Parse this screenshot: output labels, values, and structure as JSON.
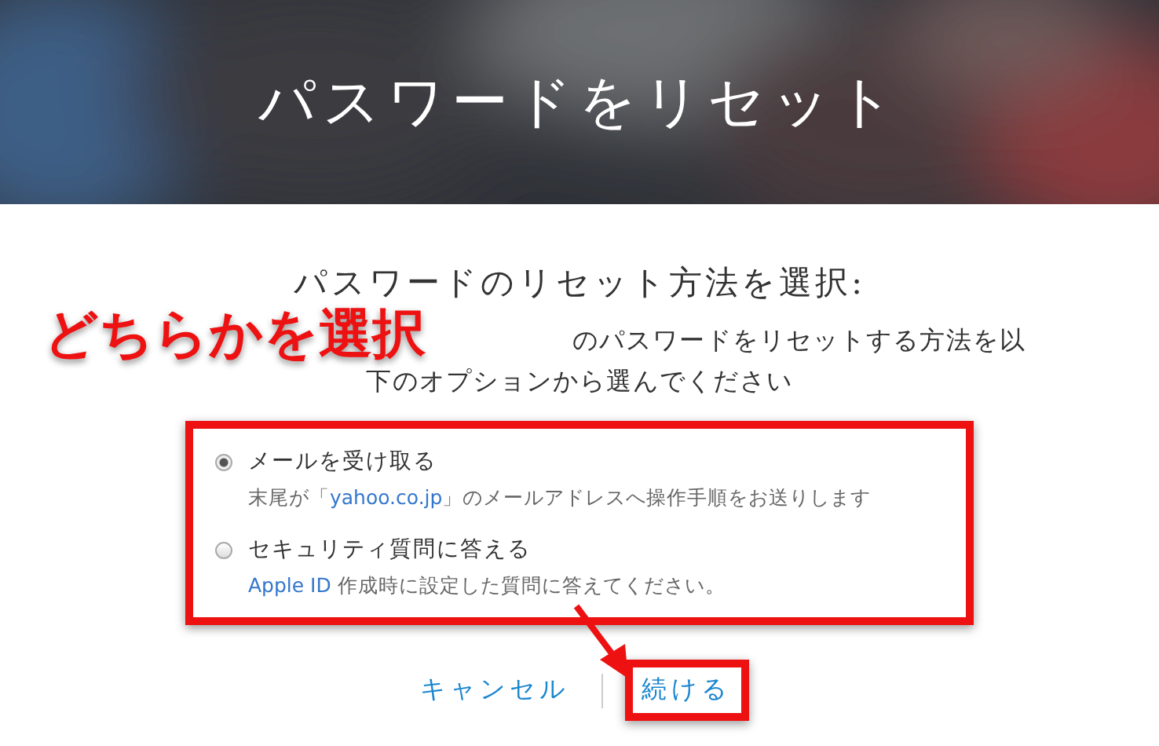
{
  "header": {
    "title": "パスワードをリセット"
  },
  "heading": "パスワードのリセット方法を選択:",
  "description_lines": [
    "のパスワードをリセットする方法を以",
    "下のオプションから選んでください"
  ],
  "options_highlighted": true,
  "options": [
    {
      "label": "メールを受け取る",
      "selected": true,
      "detail_prefix": "末尾が「",
      "detail_link": "yahoo.co.jp",
      "detail_suffix": "」のメールアドレスへ操作手順をお送りします"
    },
    {
      "label": "セキュリティ質問に答える",
      "selected": false,
      "detail_link": "Apple ID",
      "detail_suffix": " 作成時に設定した質問に答えてください。"
    }
  ],
  "buttons": [
    {
      "label": "キャンセル",
      "highlighted": false
    },
    {
      "label": "続ける",
      "highlighted": true
    }
  ],
  "annotation": {
    "label": "どちらかを選択"
  }
}
